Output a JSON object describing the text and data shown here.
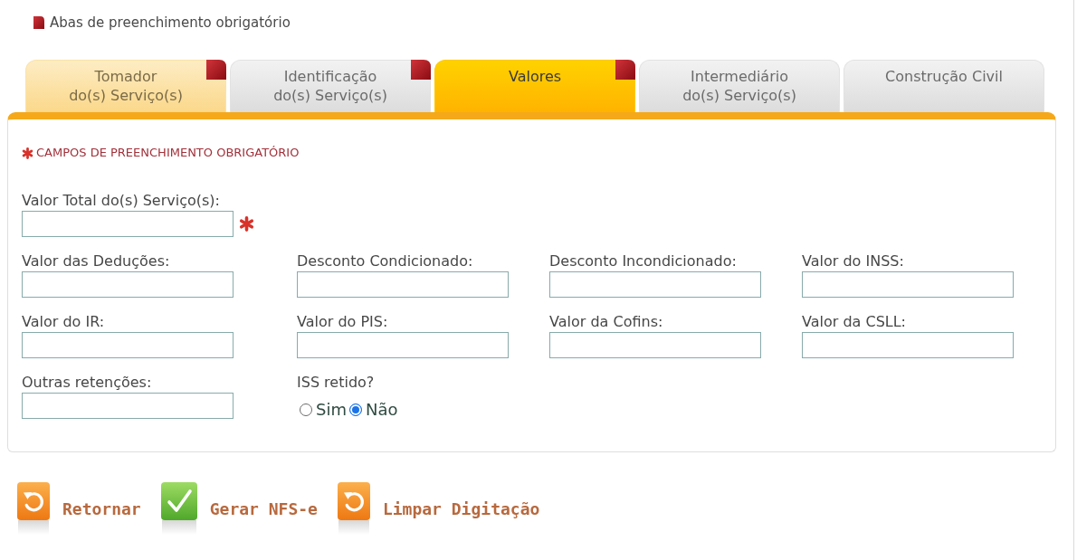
{
  "legend": "Abas de preenchimento obrigatório",
  "tabs": [
    {
      "lines": [
        "Tomador",
        "do(s) Serviço(s)"
      ],
      "selected": false,
      "highlighted": true,
      "required": true
    },
    {
      "lines": [
        "Identificação",
        "do(s) Serviço(s)"
      ],
      "selected": false,
      "highlighted": false,
      "required": true
    },
    {
      "lines": [
        "Valores"
      ],
      "selected": true,
      "highlighted": false,
      "required": true
    },
    {
      "lines": [
        "Intermediário",
        "do(s) Serviço(s)"
      ],
      "selected": false,
      "highlighted": false,
      "required": false
    },
    {
      "lines": [
        "Construção Civil"
      ],
      "selected": false,
      "highlighted": false,
      "required": false
    }
  ],
  "panel": {
    "required_note": "CAMPOS DE PREENCHIMENTO OBRIGATÓRIO",
    "rows": [
      {
        "fields": [
          {
            "kind": "text",
            "label": "Valor Total do(s) Serviço(s):",
            "required": true
          }
        ]
      },
      {
        "fields": [
          {
            "kind": "text",
            "label": "Valor das Deduções:",
            "required": false
          },
          {
            "kind": "text",
            "label": "Desconto Condicionado:",
            "required": false
          },
          {
            "kind": "text",
            "label": "Desconto Incondicionado:",
            "required": false
          },
          {
            "kind": "text",
            "label": "Valor do INSS:",
            "required": false
          }
        ]
      },
      {
        "fields": [
          {
            "kind": "text",
            "label": "Valor do IR:",
            "required": false
          },
          {
            "kind": "text",
            "label": "Valor do PIS:",
            "required": false
          },
          {
            "kind": "text",
            "label": "Valor da Cofins:",
            "required": false
          },
          {
            "kind": "text",
            "label": "Valor da CSLL:",
            "required": false
          }
        ]
      },
      {
        "fields": [
          {
            "kind": "text",
            "label": "Outras retenções:",
            "required": false
          },
          {
            "kind": "radio",
            "label": "ISS retido?",
            "options": [
              {
                "label": "Sim",
                "selected": false
              },
              {
                "label": "Não",
                "selected": true
              }
            ]
          }
        ]
      }
    ]
  },
  "buttons": [
    {
      "kind": "undo",
      "label": "Retornar"
    },
    {
      "kind": "check",
      "label": "Gerar NFS-e"
    },
    {
      "kind": "undo",
      "label": "Limpar Digitação"
    }
  ]
}
